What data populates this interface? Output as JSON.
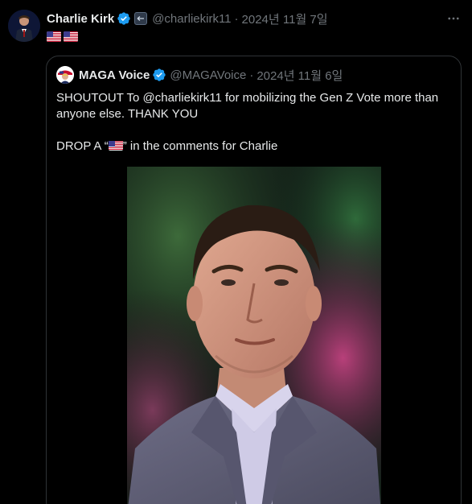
{
  "post": {
    "author": {
      "name": "Charlie Kirk",
      "handle": "@charliekirk11",
      "date": "2024년 11월 7일"
    },
    "separator": "·",
    "body_flags": [
      "us-flag-emoji",
      "us-flag-emoji"
    ]
  },
  "quote": {
    "author": {
      "name": "MAGA Voice",
      "handle": "@MAGAVoice",
      "date": "2024년 11월 6일"
    },
    "separator": "·",
    "text_line1": "SHOUTOUT To @charliekirk11 for mobilizing the Gen Z Vote more than anyone else. THANK YOU",
    "text_line2_before": "DROP A “",
    "text_line2_after": "” in the comments for Charlie",
    "image_alt": "photo"
  },
  "colors": {
    "background": "#000000",
    "text_primary": "#e7e9ea",
    "text_secondary": "#71767b",
    "border": "#2f3336",
    "verified_blue": "#1d9bf0"
  },
  "icons": {
    "verified": "verified-badge-icon",
    "affiliate": "affiliate-badge-icon",
    "more": "more-icon"
  }
}
